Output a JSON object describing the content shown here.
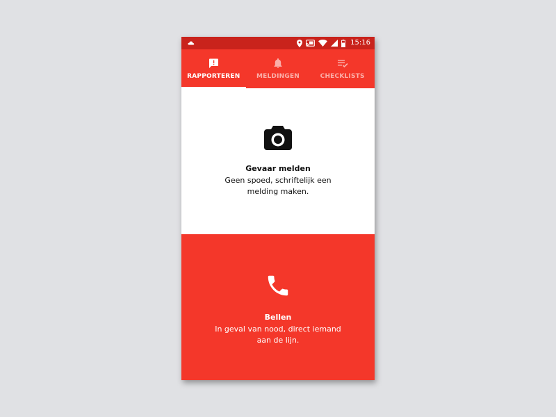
{
  "statusbar": {
    "time": "15:16",
    "icons": [
      "cloud-icon",
      "location-icon",
      "cast-icon",
      "wifi-icon",
      "signal-icon",
      "battery-icon"
    ]
  },
  "tabs": [
    {
      "label": "RAPPORTEREN",
      "icon": "report-icon",
      "active": true
    },
    {
      "label": "MELDINGEN",
      "icon": "bell-icon",
      "active": false
    },
    {
      "label": "CHECKLISTS",
      "icon": "checklist-icon",
      "active": false
    }
  ],
  "report_panel": {
    "icon": "camera-icon",
    "title": "Gevaar melden",
    "description": "Geen spoed, schriftelijk een melding maken."
  },
  "call_panel": {
    "icon": "phone-icon",
    "title": "Bellen",
    "description": "In geval van nood, direct iemand aan de lijn."
  },
  "colors": {
    "primary": "#f4372a",
    "statusbar": "#c9231c",
    "background": "#e0e1e4"
  }
}
